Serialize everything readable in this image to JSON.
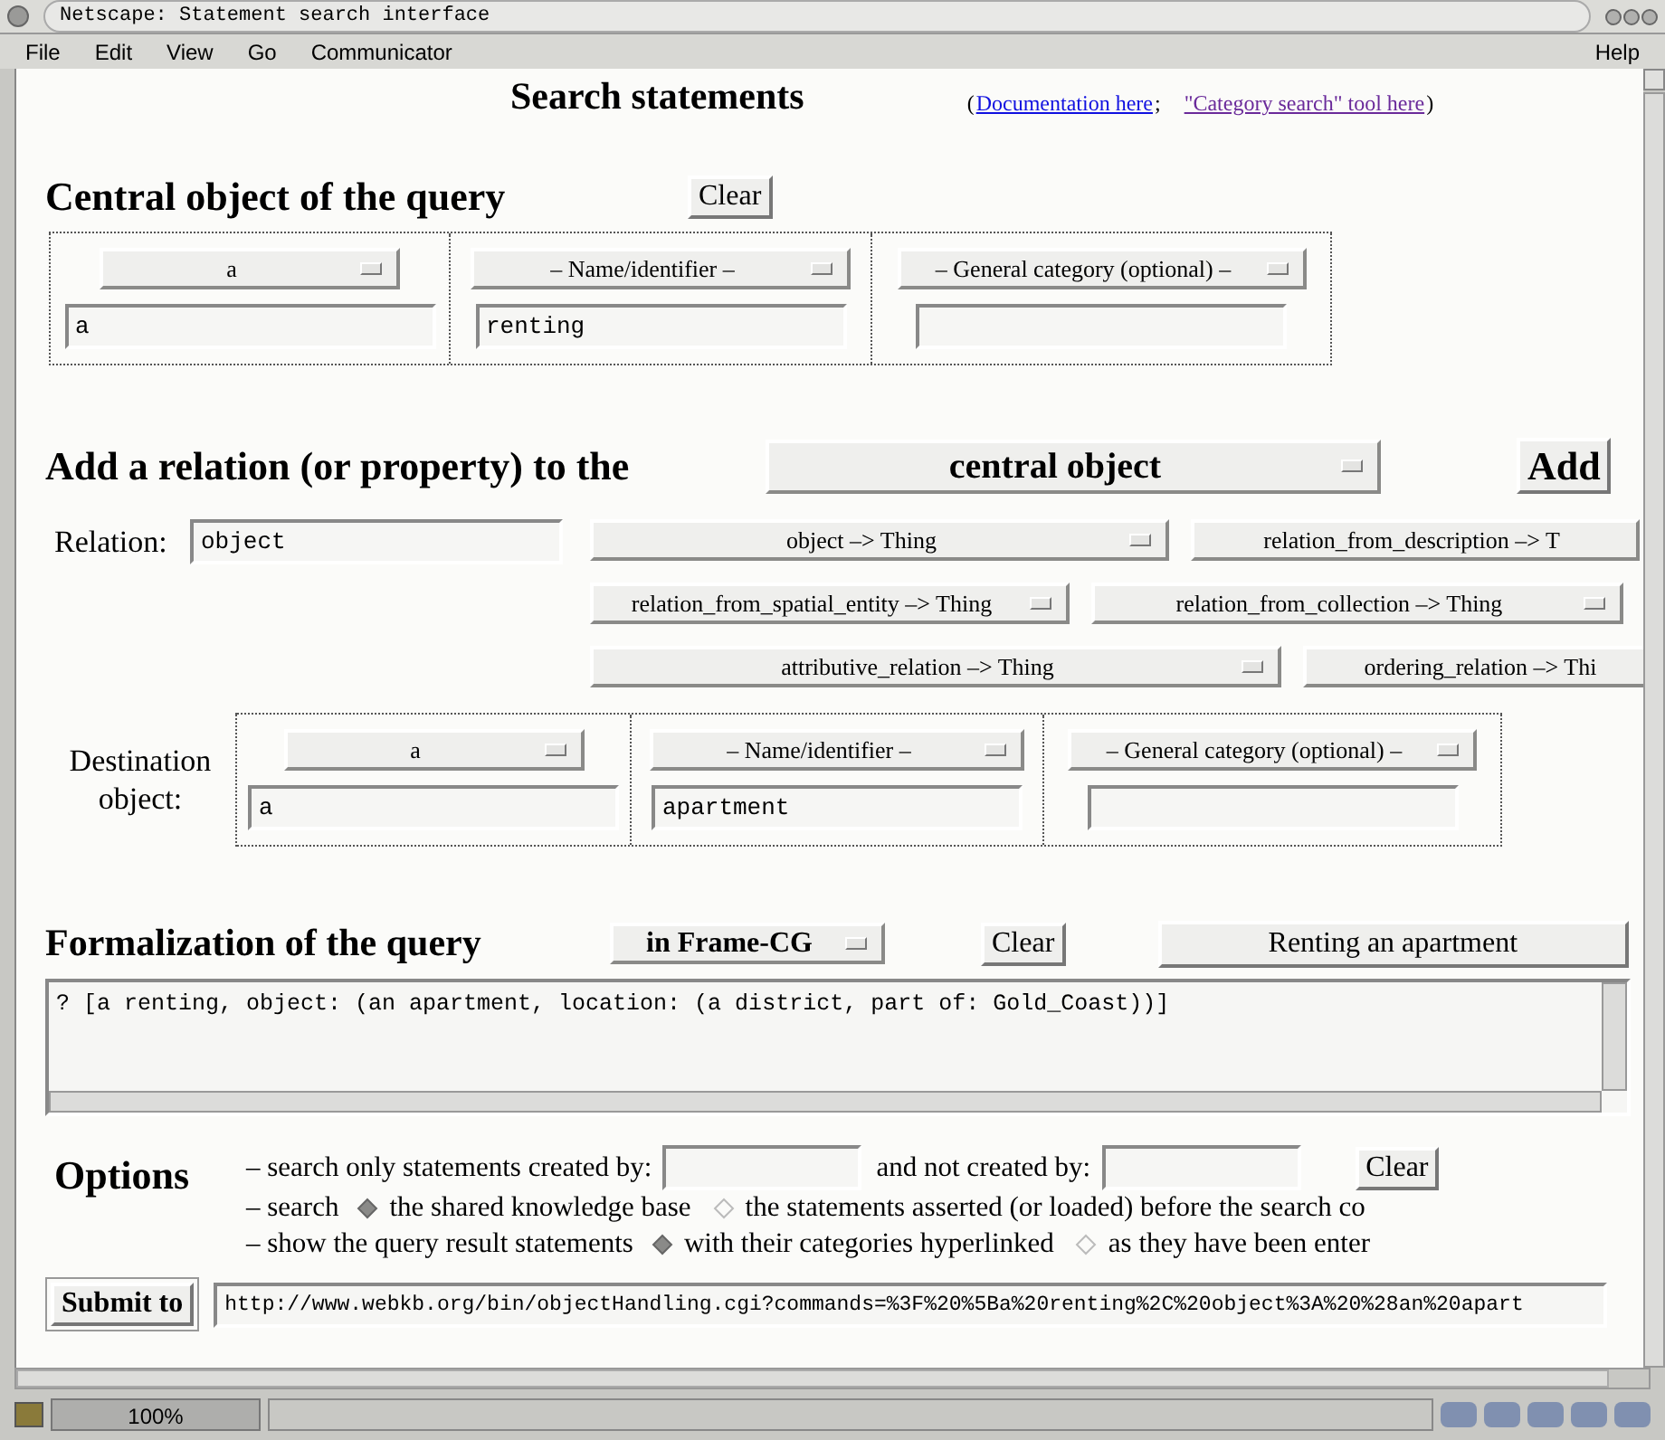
{
  "window": {
    "title": "Netscape: Statement search interface"
  },
  "menu": [
    "File",
    "Edit",
    "View",
    "Go",
    "Communicator"
  ],
  "help_menu": "Help",
  "header": {
    "title": "Search statements",
    "prefix": "(",
    "separator": ";",
    "suffix": ")",
    "links": [
      {
        "label": "Documentation here",
        "visited": false
      },
      {
        "label": "\"Category search\" tool here",
        "visited": true
      }
    ]
  },
  "central": {
    "heading": "Central object of the query",
    "clear_button": "Clear",
    "fields": [
      {
        "selector": "a",
        "value": "a"
      },
      {
        "selector": "– Name/identifier –",
        "value": "renting"
      },
      {
        "selector": "– General category (optional) –"
      }
    ]
  },
  "relation": {
    "heading": "Add a relation (or property) to the",
    "target": "central object",
    "add_button": "Add",
    "label": "Relation:",
    "value": "object",
    "rows": [
      [
        {
          "label": "object –> Thing",
          "cut": false
        },
        {
          "label": "relation_from_description –> T",
          "cut": true
        }
      ],
      [
        {
          "label": "relation_from_spatial_entity –> Thing",
          "cut": false
        },
        {
          "label": "relation_from_collection –> Thing",
          "cut": false
        }
      ],
      [
        {
          "label": "attributive_relation –> Thing",
          "cut": false
        },
        {
          "label": "ordering_relation –> Thi",
          "cut": true
        }
      ]
    ]
  },
  "destination": {
    "label": "Destination object:",
    "fields": [
      {
        "selector": "a",
        "value": "a"
      },
      {
        "selector": "– Name/identifier –",
        "value": "apartment"
      },
      {
        "selector": "– General category (optional) –"
      }
    ]
  },
  "formalization": {
    "heading": "Formalization of the query",
    "language": "in Frame-CG",
    "clear_button": "Clear",
    "example_button": "Renting an apartment",
    "query": "? [a renting, object: (an apartment, location: (a district, part of: Gold_Coast))]"
  },
  "options": {
    "heading": "Options",
    "created_by_label": "– search only statements created by:",
    "not_created_by_label": "and not created by:",
    "clear_button": "Clear",
    "search_label": "– search",
    "search_choices": [
      {
        "label": "the shared knowledge base",
        "selected": true
      },
      {
        "label": "the statements asserted (or loaded) before the search co",
        "selected": false
      }
    ],
    "show_label": "– show the query result statements",
    "show_choices": [
      {
        "label": "with their categories hyperlinked",
        "selected": true
      },
      {
        "label": "as they have been enter",
        "selected": false
      }
    ]
  },
  "submit": {
    "button": "Submit to",
    "url": "http://www.webkb.org/bin/objectHandling.cgi?commands=%3F%20%5Ba%20renting%2C%20object%3A%20%28an%20apart"
  },
  "status_bar": {
    "zoom": "100%"
  }
}
